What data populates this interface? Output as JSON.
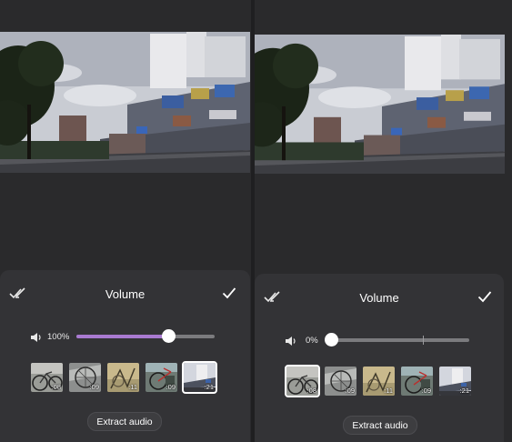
{
  "left": {
    "title": "Volume",
    "volume_percent": 100,
    "volume_label": "100%",
    "extract_label": "Extract audio",
    "clips": [
      {
        "duration": ":08",
        "selected": false
      },
      {
        "duration": ":09",
        "selected": false
      },
      {
        "duration": ":11",
        "selected": false
      },
      {
        "duration": ":09",
        "selected": false
      },
      {
        "duration": ":21",
        "selected": true
      }
    ]
  },
  "right": {
    "title": "Volume",
    "volume_percent": 0,
    "volume_label": "0%",
    "extract_label": "Extract audio",
    "clips": [
      {
        "duration": ":08",
        "selected": true
      },
      {
        "duration": ":09",
        "selected": false
      },
      {
        "duration": ":11",
        "selected": false
      },
      {
        "duration": ":09",
        "selected": false
      },
      {
        "duration": ":21",
        "selected": false
      }
    ]
  },
  "colors": {
    "accent_fill": "#a97ad1",
    "background": "#2a2a2c",
    "sheet": "#333336"
  },
  "icons": {
    "cancel": "double-check-icon",
    "confirm": "check-icon",
    "volume": "speaker-icon"
  }
}
